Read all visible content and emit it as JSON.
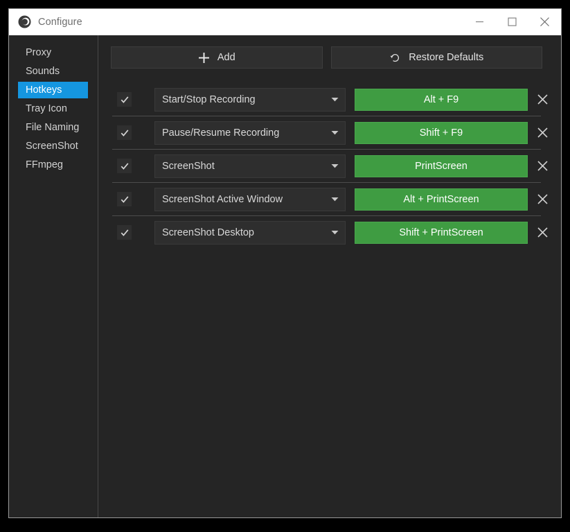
{
  "window": {
    "title": "Configure",
    "app_icon": "app-logo-icon",
    "controls": [
      {
        "name": "minimize-button",
        "icon": "minimize-icon"
      },
      {
        "name": "maximize-button",
        "icon": "maximize-icon"
      },
      {
        "name": "close-button",
        "icon": "close-icon"
      }
    ]
  },
  "sidebar": {
    "items": [
      {
        "label": "Proxy",
        "active": false
      },
      {
        "label": "Sounds",
        "active": false
      },
      {
        "label": "Hotkeys",
        "active": true
      },
      {
        "label": "Tray Icon",
        "active": false
      },
      {
        "label": "File Naming",
        "active": false
      },
      {
        "label": "ScreenShot",
        "active": false
      },
      {
        "label": "FFmpeg",
        "active": false
      }
    ]
  },
  "toolbar": {
    "add_label": "Add",
    "add_icon": "plus-icon",
    "restore_label": "Restore Defaults",
    "restore_icon": "restore-circular-arrow-icon"
  },
  "hotkeys": {
    "delete_icon": "close-x-icon",
    "checkbox_icon": "checkmark-icon",
    "dropdown_icon": "chevron-down-icon",
    "rows": [
      {
        "enabled": true,
        "action": "Start/Stop Recording",
        "shortcut": "Alt + F9"
      },
      {
        "enabled": true,
        "action": "Pause/Resume Recording",
        "shortcut": "Shift + F9"
      },
      {
        "enabled": true,
        "action": "ScreenShot",
        "shortcut": "PrintScreen"
      },
      {
        "enabled": true,
        "action": "ScreenShot Active Window",
        "shortcut": "Alt + PrintScreen"
      },
      {
        "enabled": true,
        "action": "ScreenShot Desktop",
        "shortcut": "Shift + PrintScreen"
      }
    ]
  },
  "colors": {
    "accent_blue": "#1596e0",
    "hotkey_green": "#3f9c42",
    "window_bg": "#252525",
    "titlebar_bg": "#ffffff",
    "control_bg": "#2e2e2e"
  }
}
